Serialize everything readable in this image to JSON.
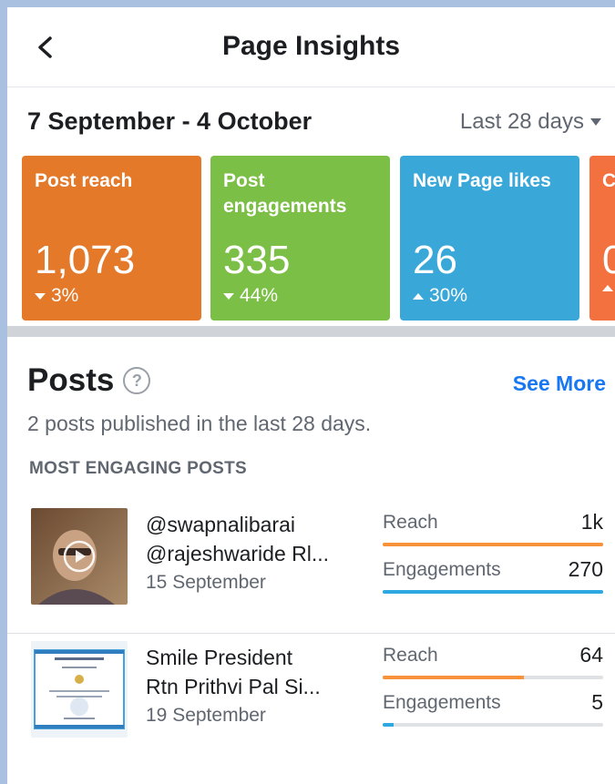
{
  "header": {
    "title": "Page Insights"
  },
  "date_row": {
    "range": "7 September - 4 October",
    "period": "Last 28 days"
  },
  "cards": [
    {
      "label": "Post reach",
      "value": "1,073",
      "change": "3%",
      "direction": "down",
      "color": "#e4792a"
    },
    {
      "label": "Post engagements",
      "value": "335",
      "change": "44%",
      "direction": "down",
      "color": "#7bbf46"
    },
    {
      "label": "New Page likes",
      "value": "26",
      "change": "30%",
      "direction": "up",
      "color": "#39a8d8"
    },
    {
      "label": "C",
      "value": "0",
      "change": "",
      "direction": "up",
      "color": "#f3703f"
    }
  ],
  "posts": {
    "title": "Posts",
    "help_symbol": "?",
    "see_more": "See More",
    "subtitle": "2 posts published in the last 28 days.",
    "section_label": "MOST ENGAGING POSTS",
    "items": [
      {
        "line1": "@swapnalibarai",
        "line2": "@rajeshwaride Rl...",
        "date": "15 September",
        "reach_label": "Reach",
        "reach_value": "1k",
        "reach_fraction": 1.0,
        "engagements_label": "Engagements",
        "engagements_value": "270",
        "engagements_fraction": 1.0,
        "thumb_icon": "video-play-icon"
      },
      {
        "line1": "Smile President",
        "line2": "Rtn Prithvi Pal Si...",
        "date": "19 September",
        "reach_label": "Reach",
        "reach_value": "64",
        "reach_fraction": 0.64,
        "engagements_label": "Engagements",
        "engagements_value": "5",
        "engagements_fraction": 0.05,
        "thumb_icon": "certificate-icon"
      }
    ]
  }
}
